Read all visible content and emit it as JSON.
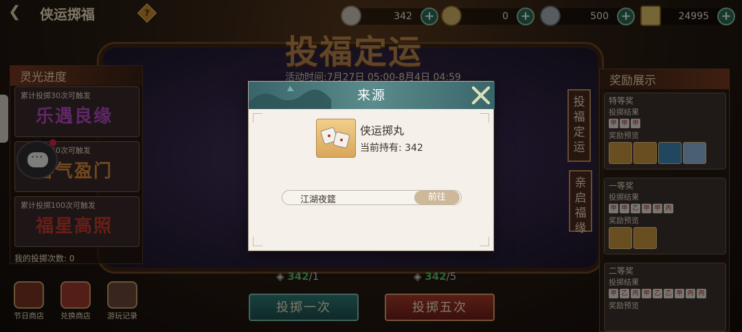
{
  "header": {
    "back_icon": "back-arrow-icon",
    "title": "侠运掷福",
    "help_icon": "help-diamond-icon",
    "resources": [
      {
        "icon": "dice-icon",
        "value": "342"
      },
      {
        "icon": "gold-dice-icon",
        "value": "0"
      },
      {
        "icon": "coin-icon",
        "value": "500"
      },
      {
        "icon": "ingot-icon",
        "value": "24995"
      }
    ]
  },
  "event": {
    "banner_title": "投福定运",
    "time_range": "活动时间:7月27日 05:00-8月4日 04:59"
  },
  "left_panel": {
    "title": "灵光进度",
    "triggers": [
      {
        "caption": "累计投掷30次可触发",
        "calligraphy": "乐遇良缘"
      },
      {
        "caption": "累计投掷60次可触发",
        "calligraphy": "喜气盈门"
      },
      {
        "caption": "累计投掷100次可触发",
        "calligraphy": "福星高照"
      }
    ],
    "my_count": "我的投掷次数: 0"
  },
  "bottom_nav": [
    {
      "label": "节日商店",
      "icon": "pavilion-icon"
    },
    {
      "label": "兑换商店",
      "icon": "exchange-bag-icon"
    },
    {
      "label": "游玩记录",
      "icon": "scroll-record-icon"
    }
  ],
  "throw": {
    "one": {
      "label": "投掷一次",
      "have": "342",
      "need": "/1"
    },
    "five": {
      "label": "投掷五次",
      "have": "342",
      "need": "/5"
    }
  },
  "reward_panel": {
    "title": "奖励展示",
    "tiers": [
      {
        "name": "特等奖",
        "result_label": "投掷结果",
        "dice": [
          "甲",
          "甲",
          "甲"
        ],
        "preview_label": "奖励预览"
      },
      {
        "name": "一等奖",
        "result_label": "投掷结果",
        "dice": [
          "甲",
          "甲",
          "乙",
          "甲",
          "甲",
          "丙"
        ],
        "preview_label": "奖励预览"
      },
      {
        "name": "二等奖",
        "result_label": "投掷结果",
        "dice": [
          "甲",
          "乙",
          "丙",
          "甲",
          "乙",
          "乙",
          "甲",
          "丙",
          "丙"
        ],
        "preview_label": "奖励预览"
      }
    ],
    "side_tabs": [
      "投福定运",
      "亲启福缘"
    ]
  },
  "modal": {
    "title": "来源",
    "close_icon": "close-x-icon",
    "item_name": "侠运掷丸",
    "item_held": "当前持有: 342",
    "item_icon": "dice-pair-icon",
    "sources": [
      {
        "name": "江湖夜筵",
        "action": "前往"
      }
    ]
  }
}
